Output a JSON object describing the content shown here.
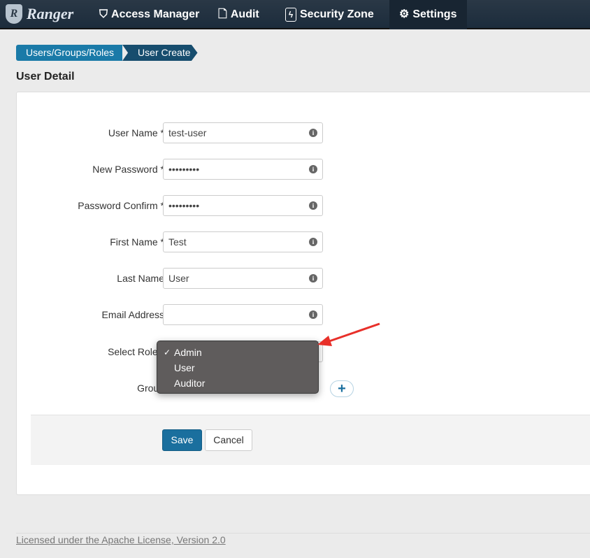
{
  "nav": {
    "brand": "Ranger",
    "items": [
      {
        "label": "Access Manager",
        "icon": "shield-icon"
      },
      {
        "label": "Audit",
        "icon": "file-icon"
      },
      {
        "label": "Security Zone",
        "icon": "lightning-icon"
      },
      {
        "label": "Settings",
        "icon": "gear-icon",
        "active": true
      }
    ]
  },
  "breadcrumb": [
    "Users/Groups/Roles",
    "User Create"
  ],
  "page_title": "User Detail",
  "form": {
    "user_name": {
      "label": "User Name *",
      "value": "test-user"
    },
    "new_password": {
      "label": "New Password *",
      "value": "•••••••••"
    },
    "password_confirm": {
      "label": "Password Confirm *",
      "value": "•••••••••"
    },
    "first_name": {
      "label": "First Name *",
      "value": "Test"
    },
    "last_name": {
      "label": "Last Name",
      "value": "User"
    },
    "email": {
      "label": "Email Address",
      "value": ""
    },
    "role": {
      "label": "Select Role *",
      "options": [
        "Admin",
        "User",
        "Auditor"
      ],
      "selected": "Admin"
    },
    "group": {
      "label": "Group",
      "add": "+"
    }
  },
  "actions": {
    "save": "Save",
    "cancel": "Cancel"
  },
  "footer": "Licensed under the Apache License, Version 2.0",
  "colors": {
    "primary": "#1a6f9e",
    "annotation_arrow": "#e8302a"
  }
}
